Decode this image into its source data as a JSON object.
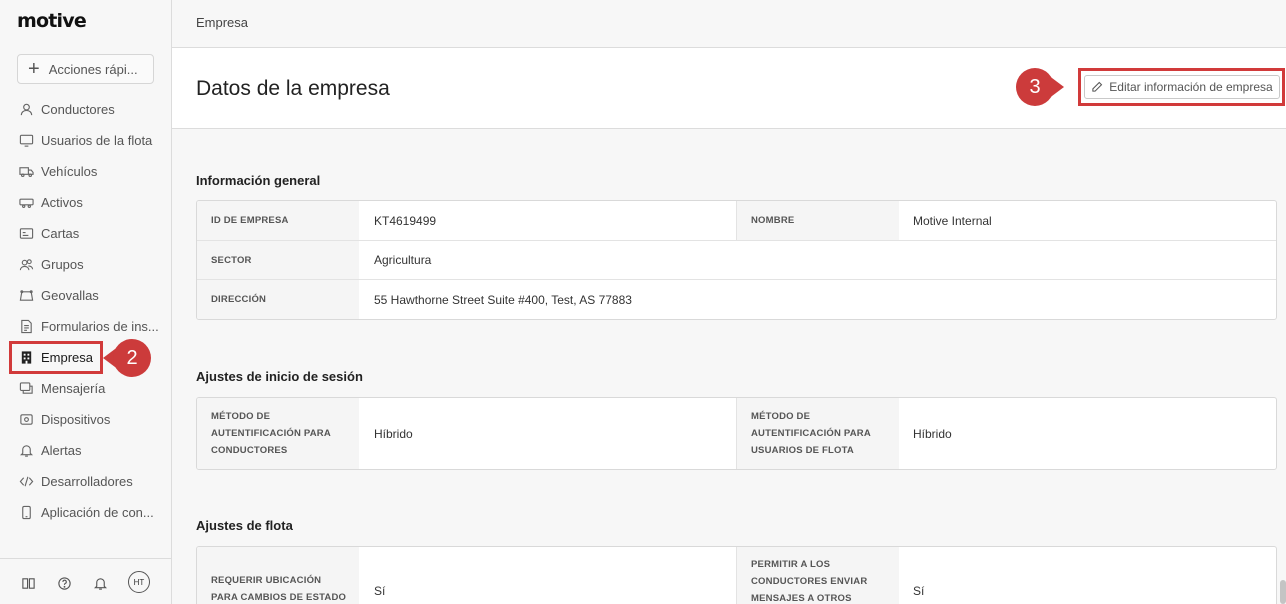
{
  "app": {
    "logo": "motive"
  },
  "sidebar": {
    "quick_actions": "Acciones rápi...",
    "items": [
      {
        "label": "Conductores",
        "icon": "user-icon"
      },
      {
        "label": "Usuarios de la flota",
        "icon": "monitor-icon"
      },
      {
        "label": "Vehículos",
        "icon": "truck-icon"
      },
      {
        "label": "Activos",
        "icon": "trailer-icon"
      },
      {
        "label": "Cartas",
        "icon": "id-card-icon"
      },
      {
        "label": "Grupos",
        "icon": "users-icon"
      },
      {
        "label": "Geovallas",
        "icon": "geofence-icon"
      },
      {
        "label": "Formularios de ins...",
        "icon": "document-icon"
      },
      {
        "label": "Empresa",
        "icon": "building-icon",
        "active": true
      },
      {
        "label": "Mensajería",
        "icon": "chat-icon"
      },
      {
        "label": "Dispositivos",
        "icon": "device-icon"
      },
      {
        "label": "Alertas",
        "icon": "bell-icon"
      },
      {
        "label": "Desarrolladores",
        "icon": "code-icon"
      },
      {
        "label": "Aplicación de con...",
        "icon": "phone-icon"
      }
    ],
    "bottom": {
      "avatar_initials": "HT"
    }
  },
  "breadcrumb": "Empresa",
  "page": {
    "title": "Datos de la empresa",
    "edit_button": "Editar información de empresa"
  },
  "callouts": {
    "step2": "2",
    "step3": "3"
  },
  "general": {
    "title": "Información general",
    "company_id_label": "ID DE EMPRESA",
    "company_id": "KT4619499",
    "name_label": "NOMBRE",
    "name": "Motive Internal",
    "sector_label": "SECTOR",
    "sector": "Agricultura",
    "address_label": "DIRECCIÓN",
    "address": "55 Hawthorne Street Suite #400, Test, AS 77883"
  },
  "login": {
    "title": "Ajustes de inicio de sesión",
    "driver_auth_label": "MÉTODO DE AUTENTIFICACIÓN PARA CONDUCTORES",
    "driver_auth": "Híbrido",
    "fleet_auth_label": "MÉTODO DE AUTENTIFICACIÓN PARA USUARIOS DE FLOTA",
    "fleet_auth": "Híbrido"
  },
  "fleet": {
    "title": "Ajustes de flota",
    "location_label": "REQUERIR UBICACIÓN PARA CAMBIOS DE ESTADO DE",
    "location": "Sí",
    "messaging_label": "PERMITIR A LOS CONDUCTORES ENVIAR MENSAJES A OTROS",
    "messaging": "Sí"
  },
  "colors": {
    "callout": "#cc3b3b",
    "highlight": "#d13a3a"
  }
}
